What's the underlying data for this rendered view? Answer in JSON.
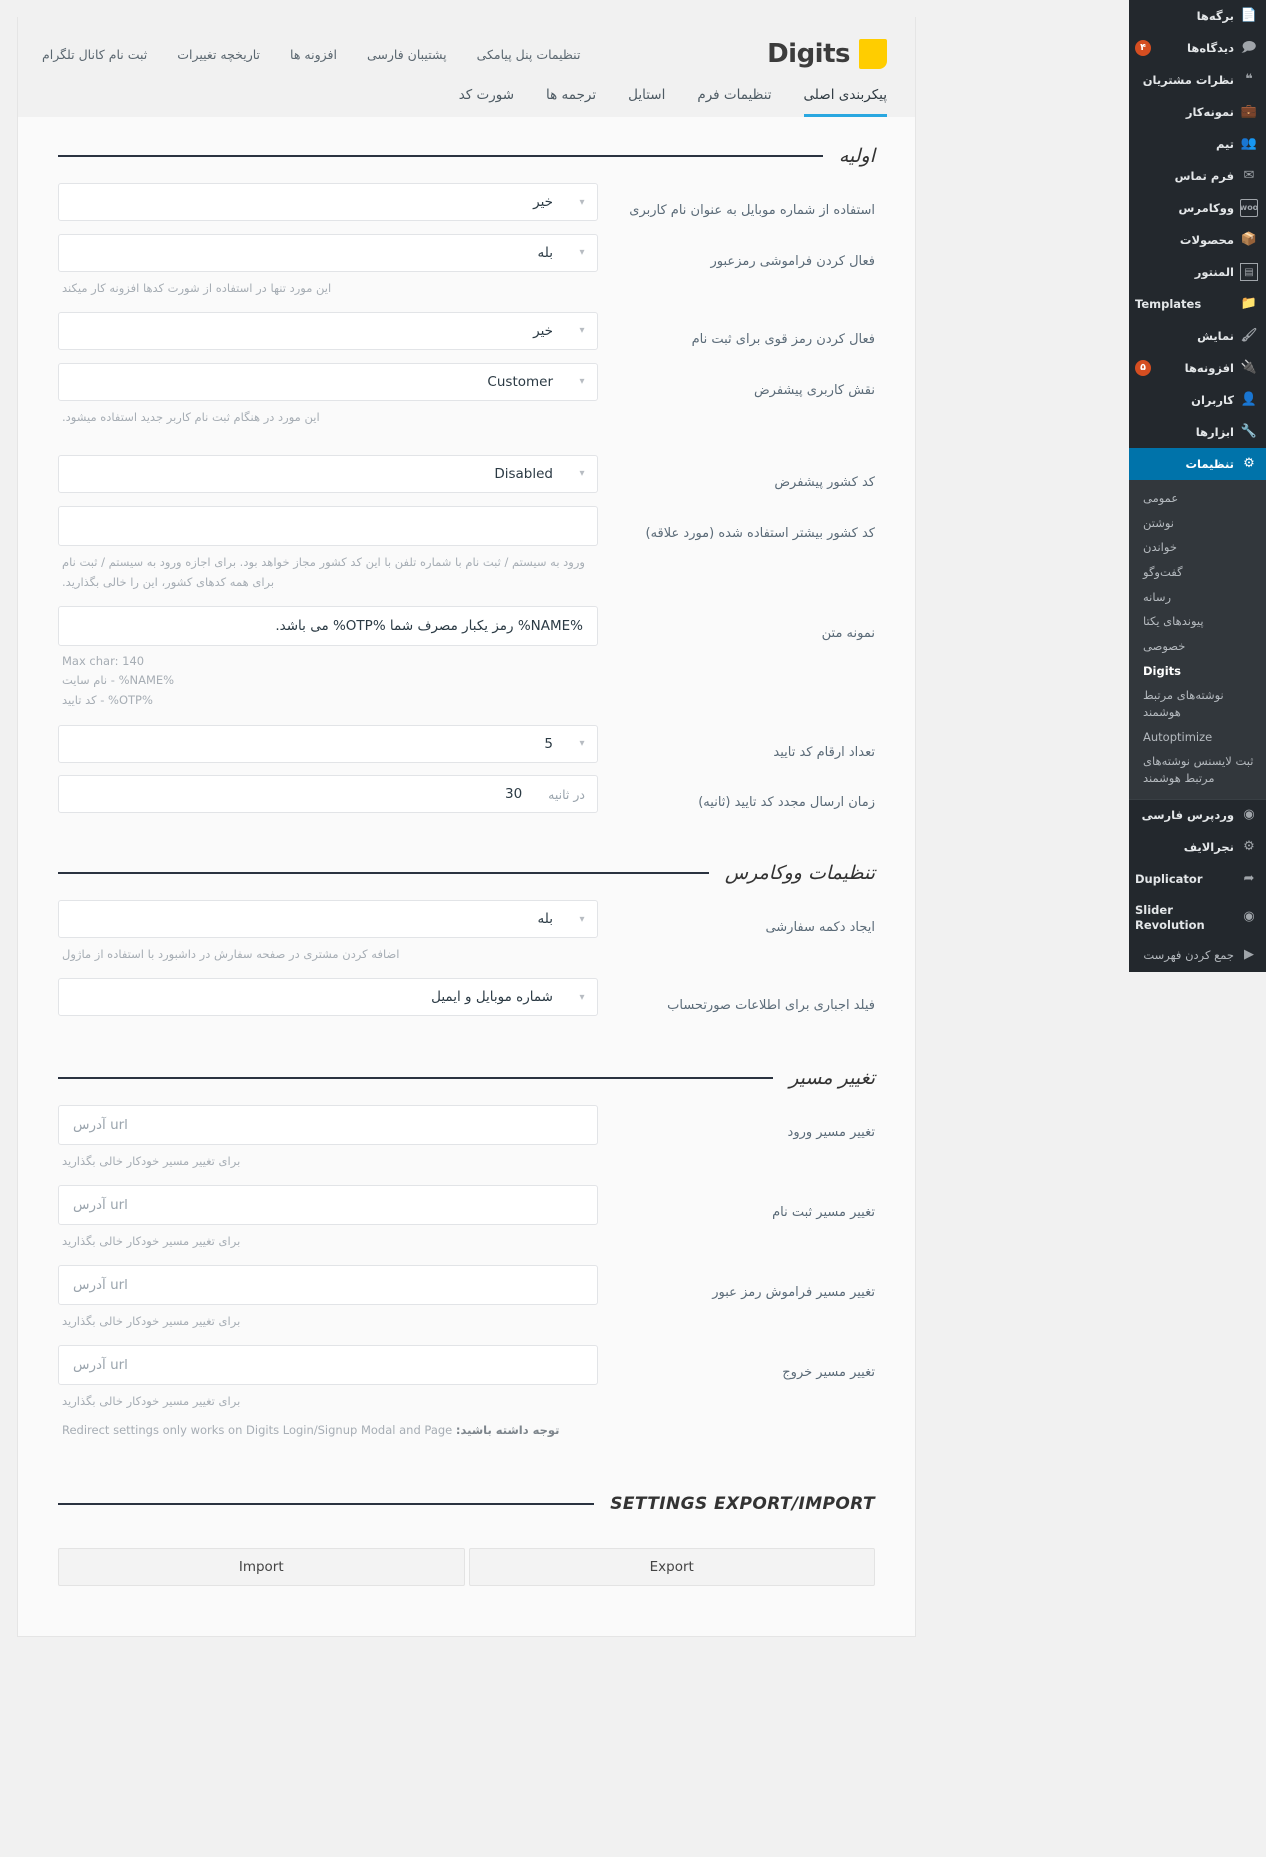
{
  "sidebar": {
    "items": [
      {
        "label": "برگه‌ها",
        "icon": "page-icon",
        "badge": null,
        "current": false
      },
      {
        "label": "دیدگاه‌ها",
        "icon": "comment-icon",
        "badge": "۴",
        "current": false
      },
      {
        "label": "نظرات مشتریان",
        "icon": "quote-icon",
        "badge": null,
        "current": false
      },
      {
        "label": "نمونه‌کار",
        "icon": "portfolio-icon",
        "badge": null,
        "current": false
      },
      {
        "label": "تیم",
        "icon": "team-icon",
        "badge": null,
        "current": false
      },
      {
        "label": "فرم تماس",
        "icon": "mail-icon",
        "badge": null,
        "current": false
      },
      {
        "label": "ووکامرس",
        "icon": "woo-icon",
        "badge": null,
        "current": false
      },
      {
        "label": "محصولات",
        "icon": "product-icon",
        "badge": null,
        "current": false
      },
      {
        "label": "المنتور",
        "icon": "elementor-icon",
        "badge": null,
        "current": false
      },
      {
        "label": "Templates",
        "icon": "templates-icon",
        "badge": null,
        "current": false
      },
      {
        "label": "نمایش",
        "icon": "appearance-icon",
        "badge": null,
        "current": false
      },
      {
        "label": "افزونه‌ها",
        "icon": "plugin-icon",
        "badge": "۵",
        "current": false
      },
      {
        "label": "کاربران",
        "icon": "users-icon",
        "badge": null,
        "current": false
      },
      {
        "label": "ابزارها",
        "icon": "tools-icon",
        "badge": null,
        "current": false
      },
      {
        "label": "تنظیمات",
        "icon": "settings-icon",
        "badge": null,
        "current": true
      }
    ],
    "submenu": [
      {
        "label": "عمومی",
        "current": false
      },
      {
        "label": "نوشتن",
        "current": false
      },
      {
        "label": "خواندن",
        "current": false
      },
      {
        "label": "گفت‌وگو",
        "current": false
      },
      {
        "label": "رسانه",
        "current": false
      },
      {
        "label": "پیوندهای یکتا",
        "current": false
      },
      {
        "label": "خصوصی",
        "current": false
      },
      {
        "label": "Digits",
        "current": true
      },
      {
        "label": "نوشته‌های مرتبط هوشمند",
        "current": false
      },
      {
        "label": "Autoptimize",
        "current": false
      },
      {
        "label": "ثبت لایسنس نوشته‌های مرتبط هوشمند",
        "current": false
      }
    ],
    "bottom_items": [
      {
        "label": "وردپرس فارسی",
        "icon": "wp-farsi-icon"
      },
      {
        "label": "نجرالایف",
        "icon": "gear-icon"
      },
      {
        "label": "Duplicator",
        "icon": "share-icon"
      },
      {
        "label": "Slider Revolution",
        "icon": "revolution-icon"
      }
    ],
    "collapse": {
      "label": "جمع کردن فهرست",
      "icon": "collapse-icon"
    }
  },
  "header": {
    "brand": "Digits",
    "top_links": [
      "تنظیمات پنل پیامکی",
      "پشتیبان فارسی",
      "افزونه ها",
      "تاریخچه تغییرات",
      "ثبت نام کانال تلگرام"
    ],
    "tabs": [
      {
        "label": "پیکربندی اصلی",
        "active": true
      },
      {
        "label": "تنظیمات فرم",
        "active": false
      },
      {
        "label": "استایل",
        "active": false
      },
      {
        "label": "ترجمه ها",
        "active": false
      },
      {
        "label": "شورت کد",
        "active": false
      }
    ]
  },
  "sections": {
    "primary": {
      "title": "اولیه",
      "fields": [
        {
          "label": "استفاده از شماره موبایل به عنوان نام کاربری",
          "type": "select",
          "value": "خیر",
          "help": null
        },
        {
          "label": "فعال کردن فراموشی رمزعبور",
          "type": "select",
          "value": "بله",
          "help": "این مورد تنها در استفاده از شورت کدها افزونه کار میکند"
        },
        {
          "label": "فعال کردن رمز قوی برای ثبت نام",
          "type": "select",
          "value": "خیر",
          "help": null
        },
        {
          "label": "نقش کاربری پیشفرض",
          "type": "select",
          "value": "Customer",
          "help": "این مورد در هنگام ثبت نام کاربر جدید استفاده میشود."
        },
        {
          "label": "کد کشور پیشفرض",
          "type": "select",
          "value": "Disabled",
          "help": null
        },
        {
          "label": "کد کشور بیشتر استفاده شده (مورد علاقه)",
          "type": "input",
          "value": "",
          "help": "ورود به سیستم / ثبت نام با شماره تلفن با این کد کشور مجاز خواهد بود. برای اجازه ورود به سیستم / ثبت نام برای همه کدهای کشور، این را خالی بگذارید."
        },
        {
          "label": "نمونه متن",
          "type": "input",
          "value": "%NAME% رمز یکبار مصرف شما %OTP% می باشد.",
          "help_lines": [
            "Max char: 140",
            "نام سایت - %NAME%",
            "کد تایید - %OTP%"
          ]
        },
        {
          "label": "تعداد ارقام کد تایید",
          "type": "select",
          "value": "5",
          "help": null
        },
        {
          "label": "زمان ارسال مجدد کد تایید (ثانیه)",
          "type": "input-suffix",
          "value": "30",
          "suffix": "در ثانیه",
          "help": null
        }
      ]
    },
    "woocommerce": {
      "title": "تنظیمات ووکامرس",
      "fields": [
        {
          "label": "ایجاد دکمه سفارشی",
          "type": "select",
          "value": "بله",
          "help": "اضافه کردن مشتری در صفحه سفارش در داشبورد با استفاده از ماژول"
        },
        {
          "label": "فیلد اجباری برای اطلاعات صورتحساب",
          "type": "select",
          "value": "شماره موبایل و ایمیل",
          "help": null
        }
      ]
    },
    "redirect": {
      "title": "تغییر مسیر",
      "fields": [
        {
          "label": "تغییر مسیر ورود",
          "type": "input",
          "value": "",
          "placeholder": "url آدرس",
          "help": "برای تغییر مسیر خودکار خالی بگذارید"
        },
        {
          "label": "تغییر مسیر ثبت نام",
          "type": "input",
          "value": "",
          "placeholder": "url آدرس",
          "help": "برای تغییر مسیر خودکار خالی بگذارید"
        },
        {
          "label": "تغییر مسیر فراموش رمز عبور",
          "type": "input",
          "value": "",
          "placeholder": "url آدرس",
          "help": "برای تغییر مسیر خودکار خالی بگذارید"
        },
        {
          "label": "تغییر مسیر خروج",
          "type": "input",
          "value": "",
          "placeholder": "url آدرس",
          "help": "برای تغییر مسیر خودکار خالی بگذارید"
        }
      ],
      "note_bold": "توجه داشته باشید:",
      "note_text": "Redirect settings only works on Digits Login/Signup Modal and Page"
    },
    "export_import": {
      "title": "SETTINGS EXPORT/IMPORT",
      "export_label": "Export",
      "import_label": "Import"
    }
  },
  "colors": {
    "wp_sidebar_bg": "#23282d",
    "wp_submenu_bg": "#32373c",
    "wp_current_blue": "#0073aa",
    "badge_orange": "#d54e21",
    "brand_yellow": "#ffcd00",
    "tab_accent": "#29a7e0",
    "rule_dark": "#2a3340"
  }
}
